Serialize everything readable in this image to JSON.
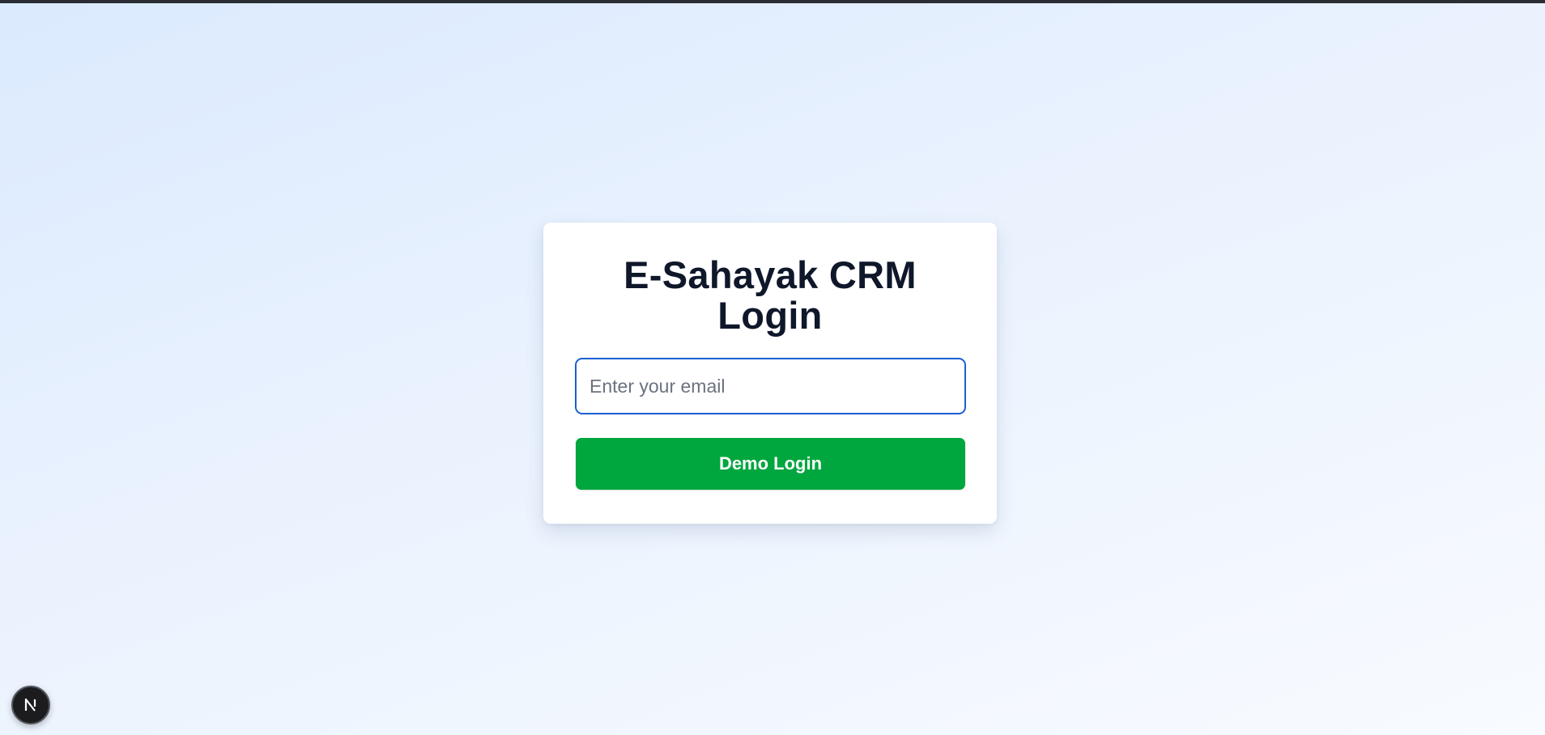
{
  "page": {
    "background": "#dbeafe"
  },
  "login_card": {
    "title": "E-Sahayak CRM Login",
    "email_placeholder": "Enter your email",
    "email_value": "",
    "demo_login_label": "Demo Login",
    "accent_color": "#00a63e",
    "input_focus_color": "#1a5fd1"
  },
  "dev_indicator": {
    "icon": "nextjs-logo-icon"
  }
}
